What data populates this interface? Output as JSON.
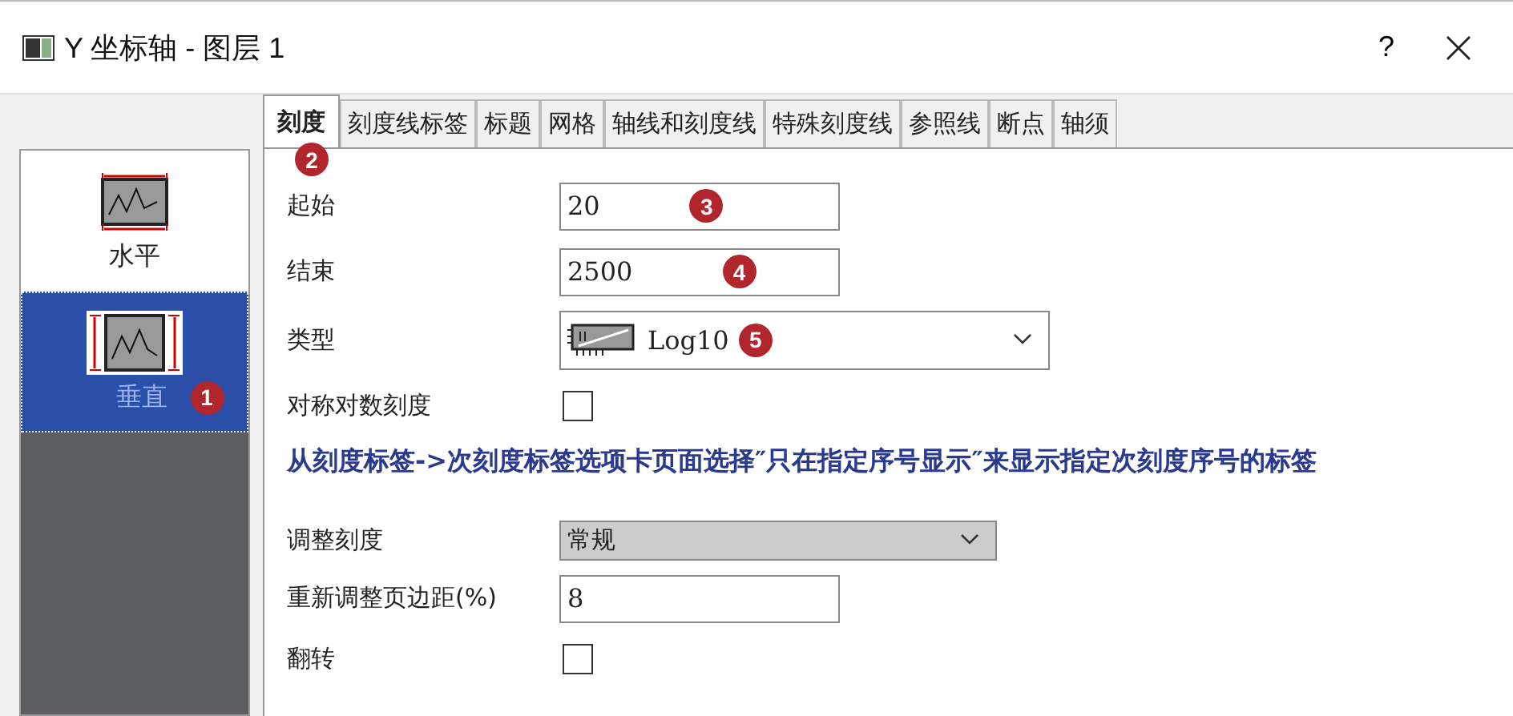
{
  "window": {
    "title": "Y 坐标轴 - 图层 1",
    "help": "?"
  },
  "sidebar": {
    "items": [
      {
        "label": "水平",
        "selected": false,
        "kind": "horizontal"
      },
      {
        "label": "垂直",
        "selected": true,
        "kind": "vertical",
        "badge": "1"
      }
    ]
  },
  "tabs": [
    {
      "label": "刻度",
      "selected": true,
      "badge": "2"
    },
    {
      "label": "刻度线标签",
      "selected": false
    },
    {
      "label": "标题",
      "selected": false
    },
    {
      "label": "网格",
      "selected": false
    },
    {
      "label": "轴线和刻度线",
      "selected": false
    },
    {
      "label": "特殊刻度线",
      "selected": false
    },
    {
      "label": "参照线",
      "selected": false
    },
    {
      "label": "断点",
      "selected": false
    },
    {
      "label": "轴须",
      "selected": false
    }
  ],
  "form": [
    {
      "kind": "text",
      "label": "起始",
      "value": "20",
      "badge": "3"
    },
    {
      "kind": "text",
      "label": "结束",
      "value": "2500",
      "badge": "4"
    },
    {
      "kind": "select",
      "label": "类型",
      "value": "Log10",
      "badge": "5",
      "disabled": false
    },
    {
      "kind": "checkbox",
      "label": "对称对数刻度",
      "checked": false
    },
    {
      "kind": "note",
      "text": "从刻度标签->次刻度标签选项卡页面选择″只在指定序号显示″来显示指定次刻度序号的标签"
    },
    {
      "kind": "select",
      "label": "调整刻度",
      "value": "常规",
      "disabled": true
    },
    {
      "kind": "text",
      "label": "重新调整页边距(%)",
      "value": "8"
    },
    {
      "kind": "checkbox",
      "label": "翻转",
      "checked": false
    }
  ]
}
